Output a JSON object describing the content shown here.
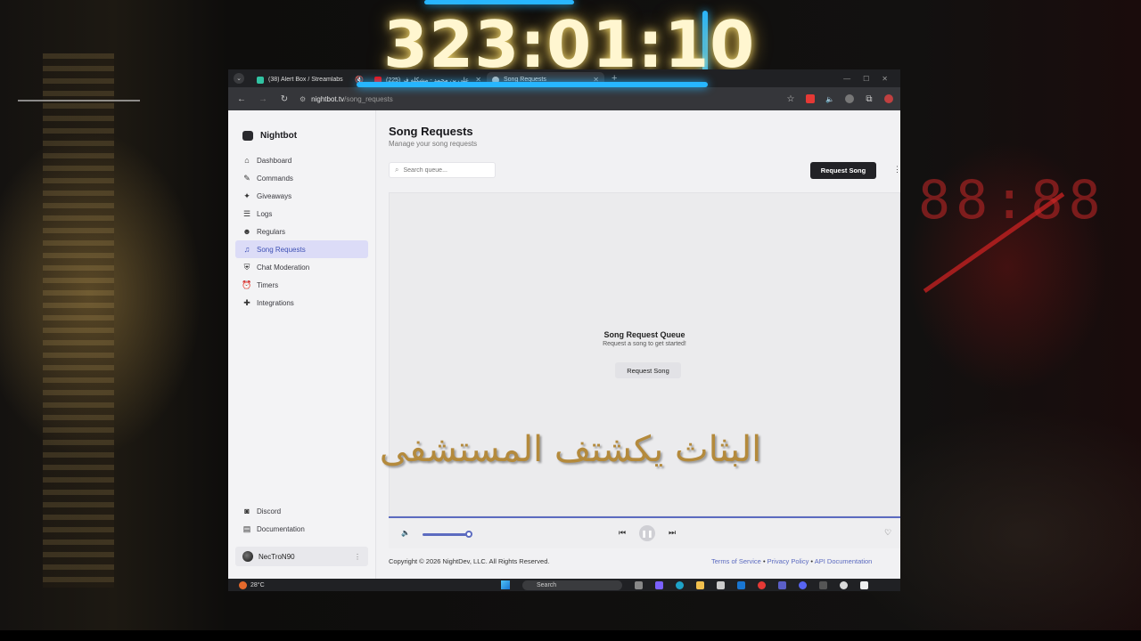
{
  "overlay": {
    "timer": "323:01:10",
    "caption": "البثاث يكشتف المستشفى"
  },
  "browser": {
    "tabs": [
      {
        "title": "(38) Alert Box / Streamlabs",
        "favicon_color": "#31c3a2",
        "active": false
      },
      {
        "title": "علي بن محمد - مشكله فر (225)",
        "favicon_color": "#ff0000",
        "active": false
      },
      {
        "title": "Song Requests",
        "favicon_color": "#bbbbbb",
        "active": true
      }
    ],
    "url_host": "nightbot.tv",
    "url_path": "/song_requests"
  },
  "sidebar": {
    "brand": "Nightbot",
    "items": [
      {
        "label": "Dashboard",
        "icon": "home-icon"
      },
      {
        "label": "Commands",
        "icon": "wand-icon"
      },
      {
        "label": "Giveaways",
        "icon": "gift-icon"
      },
      {
        "label": "Logs",
        "icon": "list-icon"
      },
      {
        "label": "Regulars",
        "icon": "users-icon"
      },
      {
        "label": "Song Requests",
        "icon": "headphones-icon",
        "active": true
      },
      {
        "label": "Chat Moderation",
        "icon": "shield-icon"
      },
      {
        "label": "Timers",
        "icon": "alarm-icon"
      },
      {
        "label": "Integrations",
        "icon": "puzzle-icon"
      }
    ],
    "bottom_links": [
      {
        "label": "Discord",
        "icon": "discord-icon"
      },
      {
        "label": "Documentation",
        "icon": "book-icon"
      }
    ],
    "user": "NecTroN90"
  },
  "main": {
    "title": "Song Requests",
    "subtitle": "Manage your song requests",
    "search_placeholder": "Search queue...",
    "request_button": "Request Song",
    "queue_title": "Song Request Queue",
    "queue_subtitle": "Request a song to get started!",
    "queue_button": "Request Song",
    "player": {
      "volume": 0.9
    },
    "copyright": "Copyright © 2026 NightDev, LLC. All Rights Reserved.",
    "footer_links": [
      "Terms of Service",
      "Privacy Policy",
      "API Documentation"
    ]
  },
  "taskbar": {
    "temperature": "28°C",
    "search_label": "Search"
  }
}
